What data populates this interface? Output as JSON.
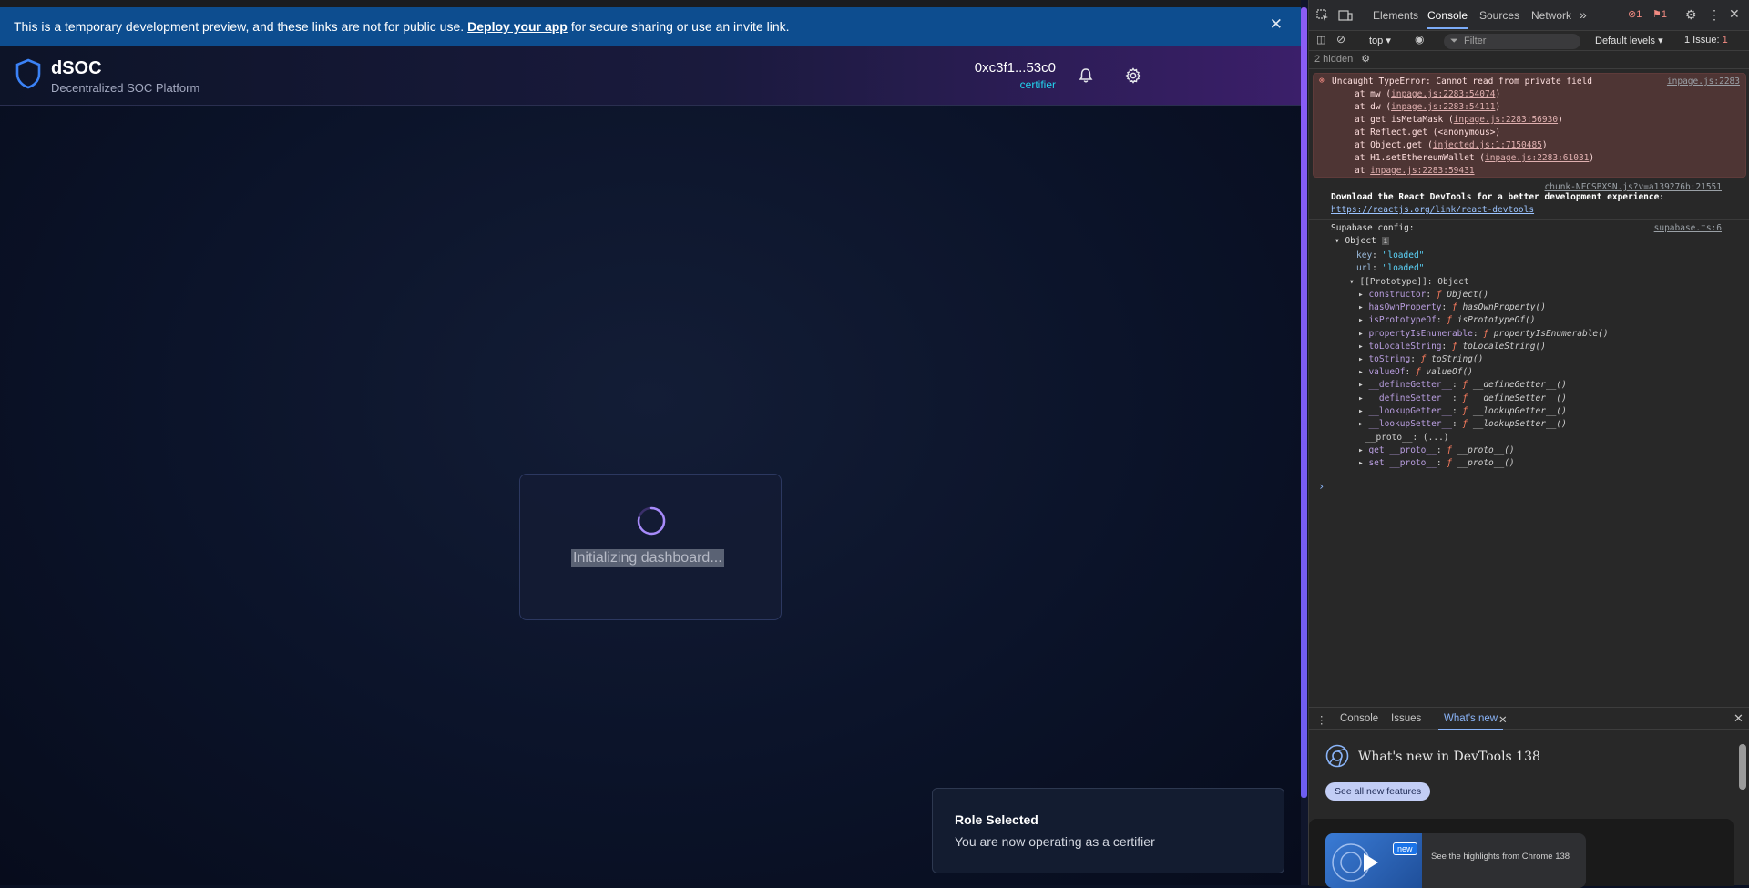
{
  "banner": {
    "text_before": "This is a temporary development preview, and these links are not for public use.",
    "link": "Deploy your app",
    "text_after": "for secure sharing or use an invite link.",
    "close": "✕"
  },
  "header": {
    "title": "dSOC",
    "subtitle": "Decentralized SOC Platform",
    "wallet_address": "0xc3f1...53c0",
    "wallet_role": "certifier"
  },
  "loading": {
    "text": "Initializing dashboard..."
  },
  "toast": {
    "title": "Role Selected",
    "message": "You are now operating as a certifier"
  },
  "devtools": {
    "tabs": [
      "Elements",
      "Console",
      "Sources",
      "Network",
      "»"
    ],
    "active_tab": "Console",
    "error_count": "1",
    "warning_count": "1",
    "context": "top",
    "filter_placeholder": "Filter",
    "levels": "Default levels",
    "issues": "1 Issue:",
    "issues_count": "1",
    "hidden": "2 hidden",
    "error": {
      "message": "Uncaught TypeError: Cannot read from private field",
      "source": "inpage.js:2283",
      "frames": [
        {
          "fn": "at mw (",
          "link": "inpage.js:2283:54074",
          "end": ")"
        },
        {
          "fn": "at dw (",
          "link": "inpage.js:2283:54111",
          "end": ")"
        },
        {
          "fn": "at get isMetaMask (",
          "link": "inpage.js:2283:56930",
          "end": ")"
        },
        {
          "fn": "at Reflect.get (<anonymous>)",
          "link": "",
          "end": ""
        },
        {
          "fn": "at Object.get (",
          "link": "injected.js:1:7150485",
          "end": ")"
        },
        {
          "fn": "at H1.setEthereumWallet (",
          "link": "inpage.js:2283:61031",
          "end": ")"
        },
        {
          "fn": "at ",
          "link": "inpage.js:2283:59431",
          "end": ""
        }
      ]
    },
    "chunk_source": "chunk-NFCSBXSN.js?v=a139276b:21551",
    "react_msg": "Download the React DevTools for a better development experience:",
    "react_link": "https://reactjs.org/link/react-devtools",
    "supabase_label": "Supabase config:",
    "supabase_source": "supabase.ts:6",
    "object_label": "Object",
    "props": [
      {
        "k": "key",
        "v": "\"loaded\""
      },
      {
        "k": "url",
        "v": "\"loaded\""
      }
    ],
    "prototype_label": "[[Prototype]]: Object",
    "proto_items": [
      {
        "k": "constructor",
        "v": "Object()"
      },
      {
        "k": "hasOwnProperty",
        "v": "hasOwnProperty()"
      },
      {
        "k": "isPrototypeOf",
        "v": "isPrototypeOf()"
      },
      {
        "k": "propertyIsEnumerable",
        "v": "propertyIsEnumerable()"
      },
      {
        "k": "toLocaleString",
        "v": "toLocaleString()"
      },
      {
        "k": "toString",
        "v": "toString()"
      },
      {
        "k": "valueOf",
        "v": "valueOf()"
      },
      {
        "k": "__defineGetter__",
        "v": "__defineGetter__()"
      },
      {
        "k": "__defineSetter__",
        "v": "__defineSetter__()"
      },
      {
        "k": "__lookupGetter__",
        "v": "__lookupGetter__()"
      },
      {
        "k": "__lookupSetter__",
        "v": "__lookupSetter__()"
      }
    ],
    "proto_dunder": "__proto__: (...)",
    "get_proto": {
      "k": "get __proto__",
      "v": "__proto__()"
    },
    "set_proto": {
      "k": "set __proto__",
      "v": "__proto__()"
    },
    "prompt": "›",
    "bottom_tabs": [
      "Console",
      "Issues",
      "What's new"
    ],
    "whats_new_title": "What's new in DevTools 138",
    "see_all": "See all new features",
    "new_badge": "new",
    "highlights": "See the highlights from Chrome 138"
  }
}
